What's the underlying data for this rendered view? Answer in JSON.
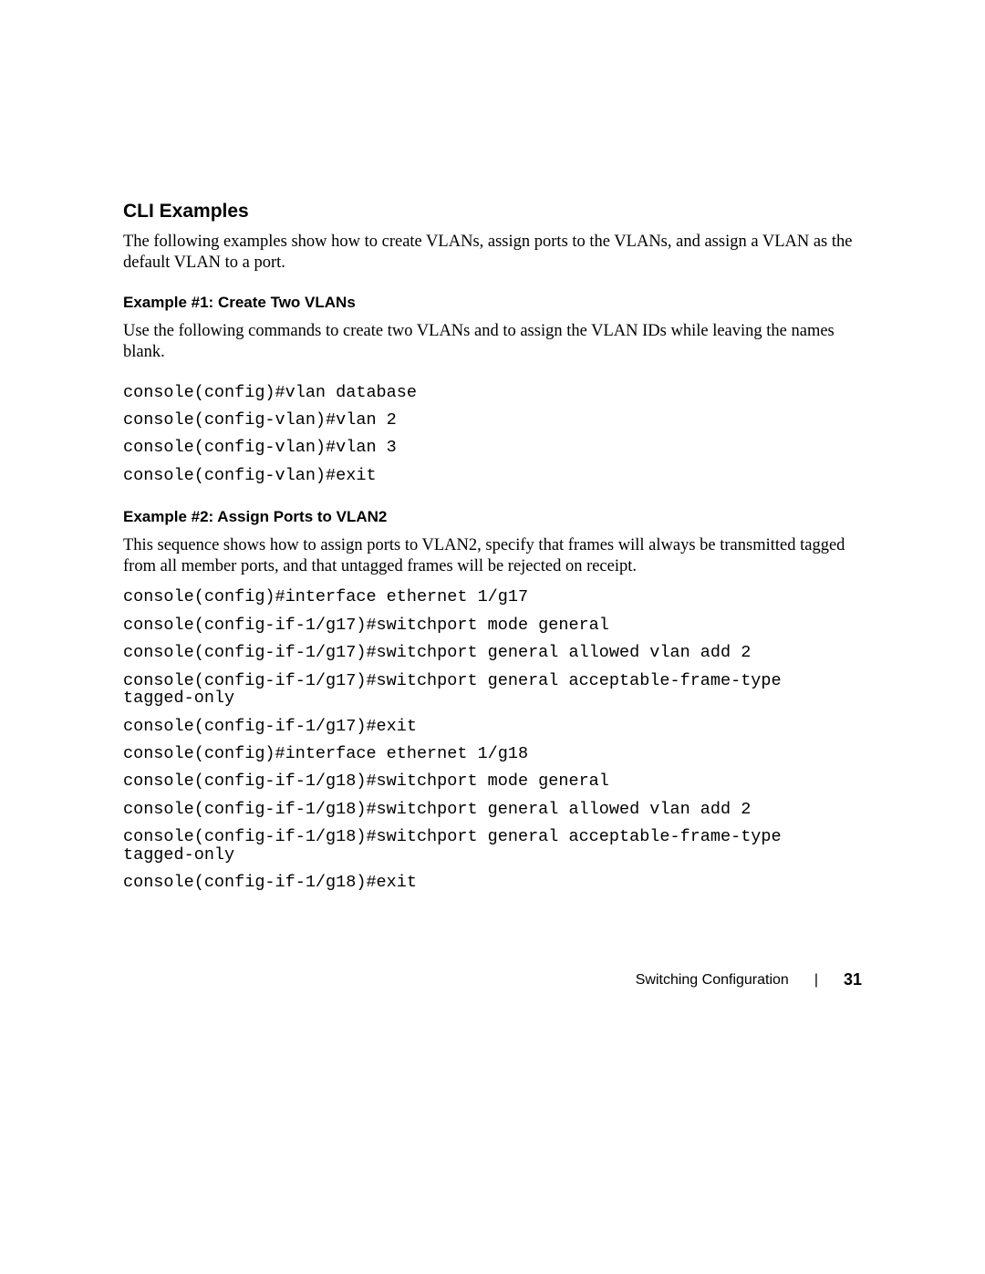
{
  "section_heading": "CLI Examples",
  "intro_paragraph": "The following examples show how to create VLANs, assign ports to the VLANs, and assign a VLAN as the default VLAN to a port.",
  "example1": {
    "heading": "Example #1: Create Two VLANs",
    "paragraph": "Use the following commands to create two VLANs and to assign the VLAN IDs while leaving the names blank.",
    "code": [
      "console(config)#vlan database",
      "console(config-vlan)#vlan 2",
      "console(config-vlan)#vlan 3",
      "console(config-vlan)#exit"
    ]
  },
  "example2": {
    "heading": "Example #2: Assign Ports to VLAN2",
    "paragraph": "This sequence shows how to assign ports to VLAN2, specify that frames will always be transmitted tagged from all member ports, and that untagged frames will be rejected on receipt.",
    "code": [
      "console(config)#interface ethernet 1/g17",
      "console(config-if-1/g17)#switchport mode general",
      "console(config-if-1/g17)#switchport general allowed vlan add 2",
      "console(config-if-1/g17)#switchport general acceptable-frame-type tagged-only",
      "console(config-if-1/g17)#exit",
      "console(config)#interface ethernet 1/g18",
      "console(config-if-1/g18)#switchport mode general",
      "console(config-if-1/g18)#switchport general allowed vlan add 2",
      "console(config-if-1/g18)#switchport general acceptable-frame-type tagged-only",
      "console(config-if-1/g18)#exit"
    ]
  },
  "footer": {
    "section": "Switching Configuration",
    "page": "31"
  }
}
